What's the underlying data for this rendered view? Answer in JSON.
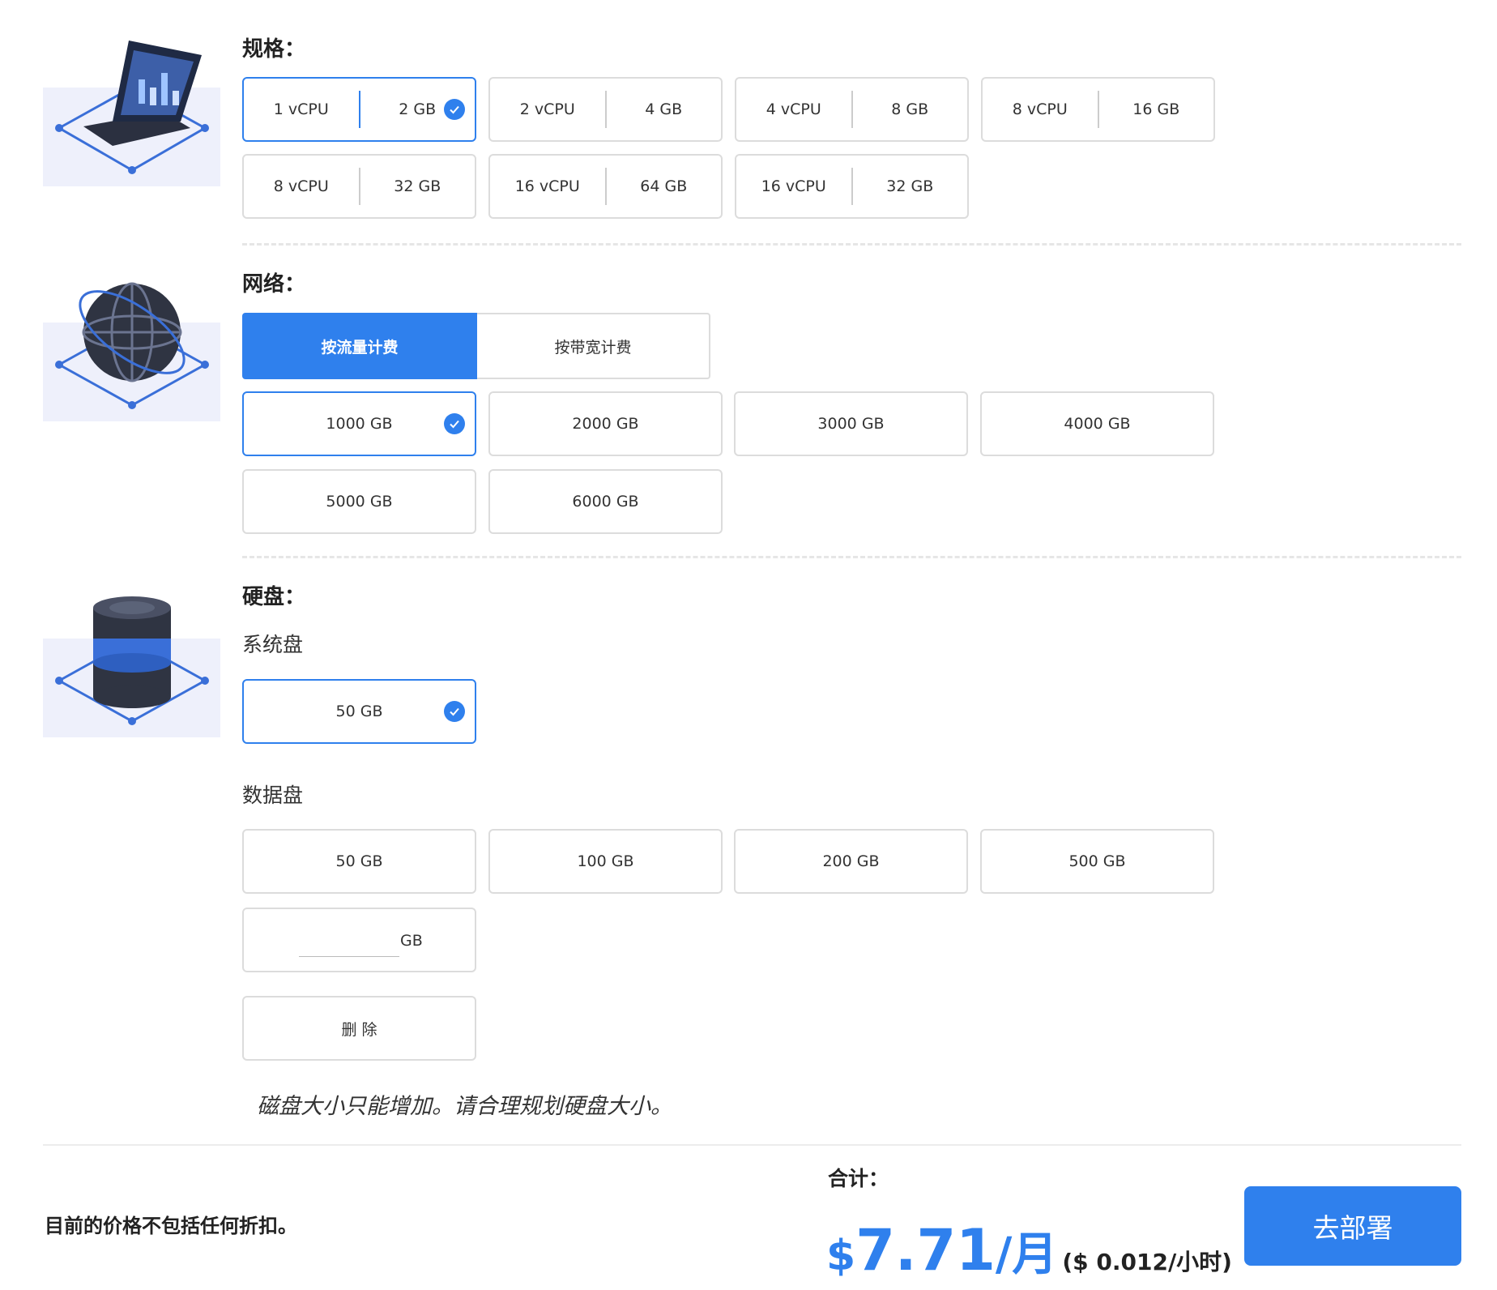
{
  "spec": {
    "title": "规格：",
    "options": [
      {
        "cpu": "1 vCPU",
        "mem": "2 GB",
        "selected": true
      },
      {
        "cpu": "2 vCPU",
        "mem": "4 GB",
        "selected": false
      },
      {
        "cpu": "4 vCPU",
        "mem": "8 GB",
        "selected": false
      },
      {
        "cpu": "8 vCPU",
        "mem": "16 GB",
        "selected": false
      },
      {
        "cpu": "8 vCPU",
        "mem": "32 GB",
        "selected": false
      },
      {
        "cpu": "16 vCPU",
        "mem": "64 GB",
        "selected": false
      },
      {
        "cpu": "16 vCPU",
        "mem": "32 GB",
        "selected": false
      }
    ]
  },
  "network": {
    "title": "网络：",
    "billing_traffic": "按流量计费",
    "billing_bandwidth": "按带宽计费",
    "options": [
      "1000 GB",
      "2000 GB",
      "3000 GB",
      "4000 GB",
      "5000 GB",
      "6000 GB"
    ],
    "selected": "1000 GB"
  },
  "disk": {
    "title": "硬盘：",
    "system_label": "系统盘",
    "system_option": "50 GB",
    "data_label": "数据盘",
    "data_options": [
      "50 GB",
      "100 GB",
      "200 GB",
      "500 GB"
    ],
    "custom_value": "",
    "custom_unit": "GB",
    "delete_label": "删 除",
    "note": "磁盘大小只能增加。请合理规划硬盘大小。"
  },
  "footer": {
    "disclaimer": "目前的价格不包括任何折扣。",
    "total_label": "合计：",
    "currency": "$",
    "amount": "7.71",
    "per_month": "/月",
    "hourly": "($ 0.012/小时)",
    "deploy_label": "去部署"
  },
  "colors": {
    "accent": "#2f80ed",
    "border": "#dcdcdc"
  },
  "icons": [
    "laptop-icon",
    "globe-icon",
    "disk-icon",
    "check-icon"
  ]
}
